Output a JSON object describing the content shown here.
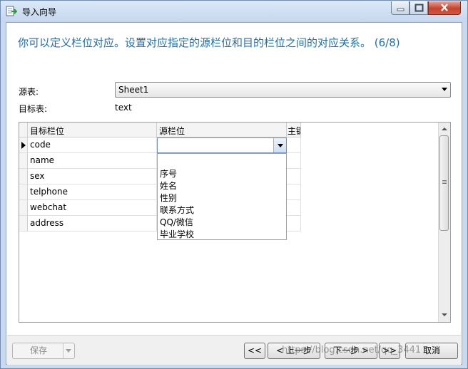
{
  "window": {
    "title": "导入向导"
  },
  "heading": "你可以定义栏位对应。设置对应指定的源栏位和目的栏位之间的对应关系。 (6/8)",
  "source_table": {
    "label": "源表:",
    "value": "Sheet1"
  },
  "target_table": {
    "label": "目标表:",
    "value": "text"
  },
  "grid": {
    "columns": [
      "目标栏位",
      "源栏位",
      "主键"
    ],
    "rows": [
      "code",
      "name",
      "sex",
      "telphone",
      "webchat",
      "address"
    ]
  },
  "dropdown": {
    "options": [
      "",
      "序号",
      "姓名",
      "性别",
      "联系方式",
      "QQ/微信",
      "毕业学校"
    ]
  },
  "buttons": {
    "save": "保存",
    "first": "<<",
    "prev": "< 上一步",
    "next": "下一步 >",
    "last": ">>",
    "cancel": "取消"
  },
  "watermark": "https://blog.csdn.net/qq_3441"
}
